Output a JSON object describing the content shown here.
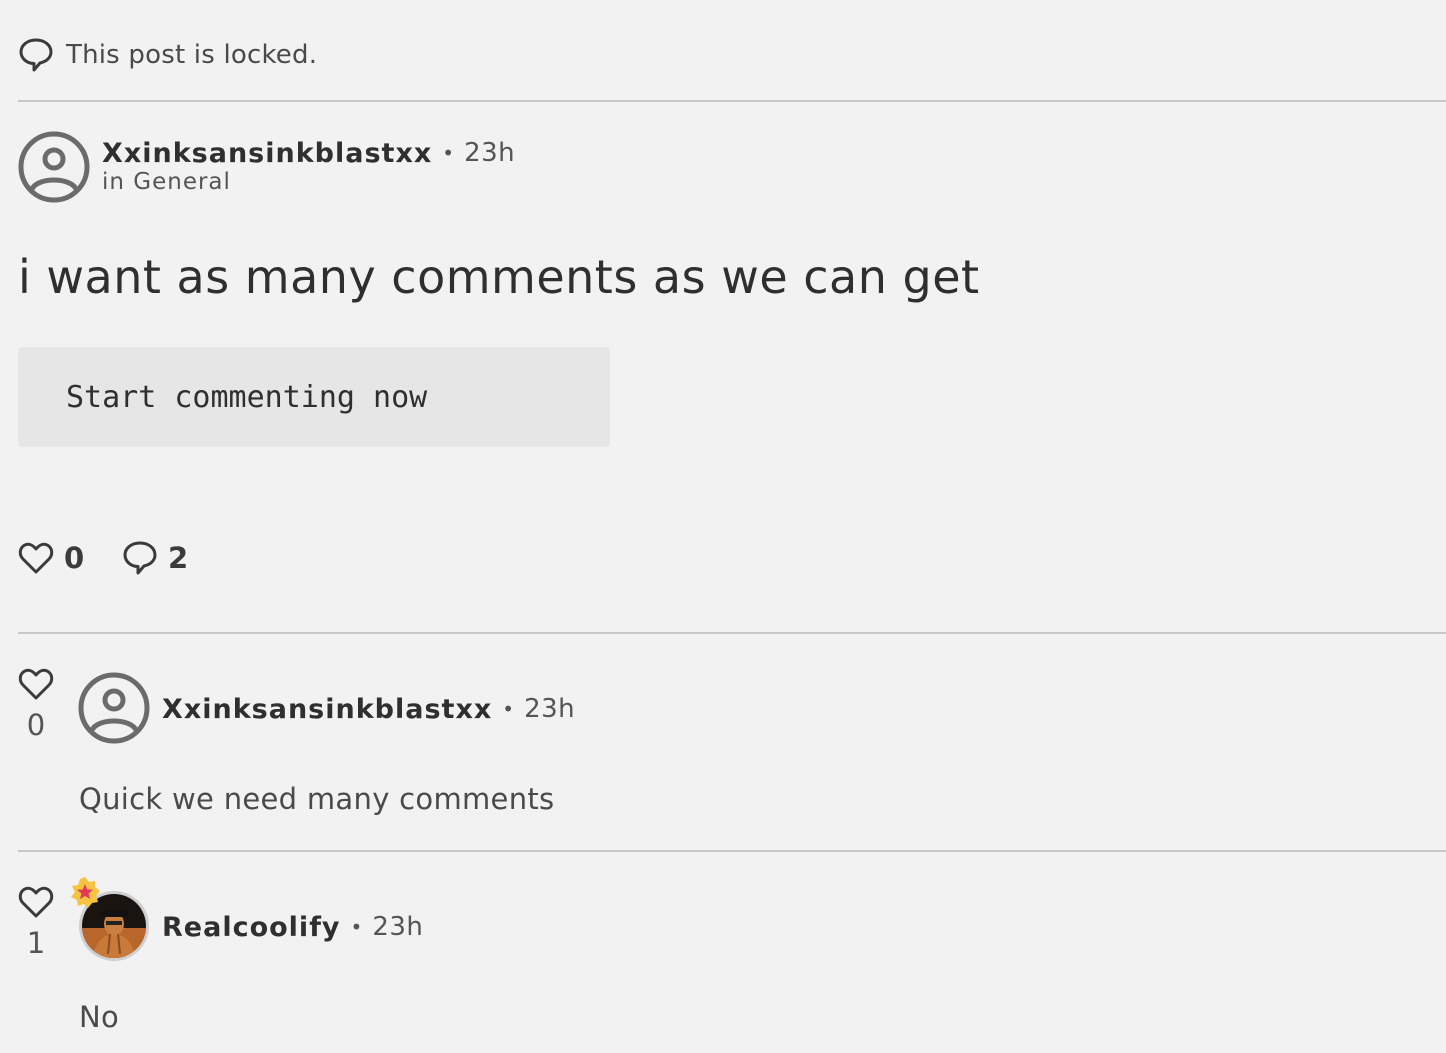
{
  "locked_notice": "This post is locked.",
  "post": {
    "author": "Xxinksansinkblastxx",
    "separator": "•",
    "time": "23h",
    "category": "in General",
    "title": "i want as many comments as we can get",
    "code_block": "Start commenting now",
    "likes": "0",
    "comments": "2"
  },
  "comments": [
    {
      "author": "Xxinksansinkblastxx",
      "separator": "•",
      "time": "23h",
      "likes": "0",
      "body": "Quick we need many comments",
      "avatar": "default-user-icon"
    },
    {
      "author": "Realcoolify",
      "separator": "•",
      "time": "23h",
      "likes": "1",
      "body": "No",
      "avatar": "user-photo",
      "badge": "star-badge-icon"
    }
  ],
  "colors": {
    "background": "#f2f2f2",
    "divider": "#c9c9c9",
    "code_bg": "#e6e6e6",
    "badge": "#f5c542",
    "badge_star": "#e03a5a"
  }
}
